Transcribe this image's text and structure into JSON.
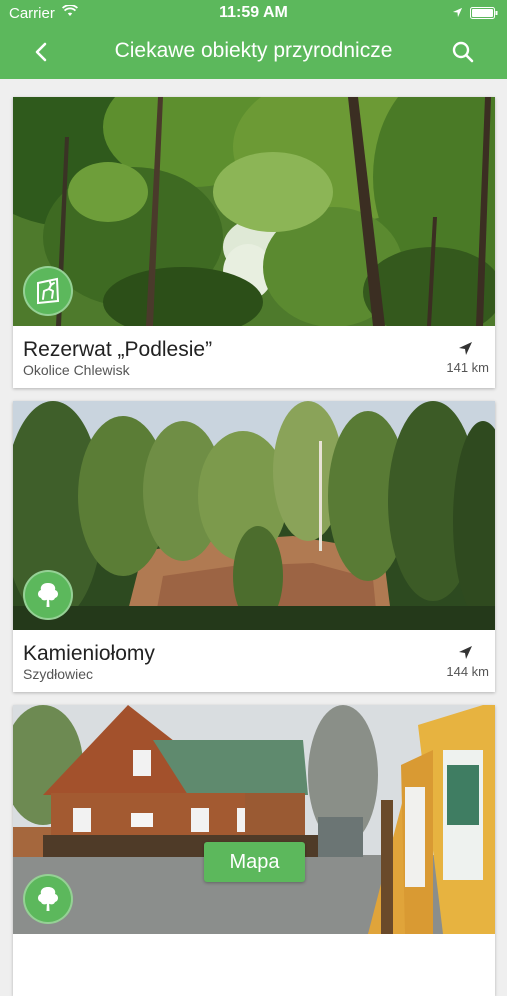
{
  "status_bar": {
    "carrier": "Carrier",
    "time": "11:59 AM"
  },
  "nav": {
    "title": "Ciekawe obiekty przyrodnicze"
  },
  "items": [
    {
      "name": "Rezerwat „Podlesie”",
      "place": "Okolice Chlewisk",
      "distance": "141 km",
      "category_icon": "deer-icon"
    },
    {
      "name": "Kamieniołomy",
      "place": "Szydłowiec",
      "distance": "144 km",
      "category_icon": "tree-icon"
    },
    {
      "name": "",
      "place": "",
      "distance": "",
      "category_icon": "tree-icon"
    }
  ],
  "map_button": {
    "label": "Mapa"
  },
  "colors": {
    "accent": "#5cb85c",
    "background": "#efefef"
  }
}
